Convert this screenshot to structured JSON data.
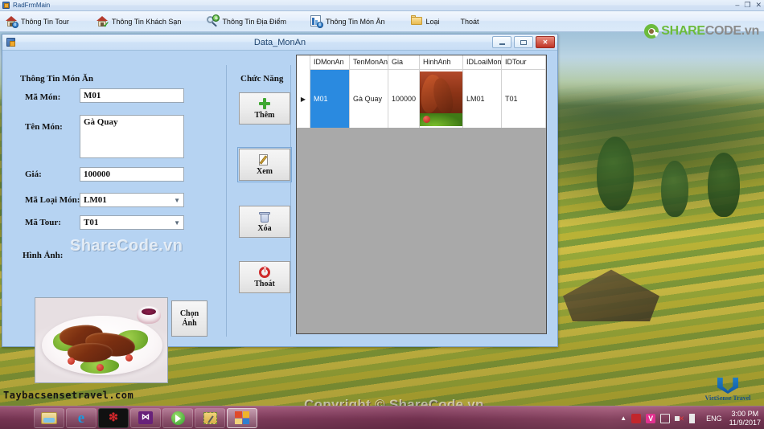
{
  "main_window": {
    "title": "RadFrmMain",
    "icon": "windows-form-icon",
    "controls": {
      "minimize": "minimize-icon",
      "restore": "restore-icon",
      "close": "close-icon"
    }
  },
  "menu": {
    "items": [
      {
        "label": "Thông Tin Tour",
        "icon": "house-info-icon"
      },
      {
        "label": "Thông Tin Khách Sạn",
        "icon": "house-check-icon"
      },
      {
        "label": "Thông Tin Địa Điểm",
        "icon": "search-plus-icon"
      },
      {
        "label": "Thông Tin Món Ăn",
        "icon": "document-info-icon"
      },
      {
        "label": "Loại",
        "icon": "folder-icon"
      },
      {
        "label": "Thoát",
        "icon": ""
      }
    ]
  },
  "brand": {
    "logo_green": "SHARE",
    "logo_gray": "CODE.vn",
    "mark": "sharecode-logo-icon"
  },
  "child_window": {
    "title": "Data_MonAn",
    "icon": "form-icon",
    "buttons": {
      "minimize": "minimize-icon",
      "maximize": "maximize-icon",
      "close": "close-icon"
    }
  },
  "form": {
    "group_title": "Thông Tin Món Ăn",
    "fields": [
      {
        "label": "Mã Món:",
        "value": "M01",
        "type": "textbox"
      },
      {
        "label": "Tên Món:",
        "value": "Gà Quay",
        "type": "multiline"
      },
      {
        "label": "Giá:",
        "value": "100000",
        "type": "textbox"
      },
      {
        "label": "Mã Loại Món:",
        "value": "LM01",
        "type": "combobox"
      },
      {
        "label": "Mã Tour:",
        "value": "T01",
        "type": "combobox"
      }
    ],
    "image_label": "Hình Ảnh:",
    "choose_image_button": "Chọn Ảnh",
    "watermark": "ShareCode.vn"
  },
  "functions": {
    "title": "Chức Năng",
    "buttons": [
      {
        "label": "Thêm",
        "icon": "plus-icon"
      },
      {
        "label": "Xem",
        "icon": "edit-icon"
      },
      {
        "label": "Xóa",
        "icon": "trash-icon"
      },
      {
        "label": "Thoát",
        "icon": "power-icon"
      }
    ]
  },
  "grid": {
    "columns": [
      "IDMonAn",
      "TenMonAn",
      "Gia",
      "HinhAnh",
      "IDLoaiMon",
      "IDTour"
    ],
    "rows": [
      {
        "selector": "▶",
        "IDMonAn": "M01",
        "TenMonAn": "Gà Quay",
        "Gia": "100000",
        "HinhAnh": "roast-chicken-thumbnail",
        "IDLoaiMon": "LM01",
        "IDTour": "T01",
        "selected_cell": "IDMonAn"
      }
    ],
    "selection_color": "#2a8ae0",
    "background_color": "#a9a9a9"
  },
  "desktop": {
    "site_caption": "Taybacsensetravel.com",
    "vietsense_logo": "VietSense Travel",
    "page_watermark": "Copyright © ShareCode.vn"
  },
  "taskbar": {
    "apps": [
      {
        "name": "file-explorer-icon"
      },
      {
        "name": "internet-explorer-icon"
      },
      {
        "name": "app-red-icon"
      },
      {
        "name": "visual-studio-icon"
      },
      {
        "name": "media-player-icon"
      },
      {
        "name": "tools-icon"
      },
      {
        "name": "running-app-icon",
        "active": true
      }
    ],
    "tray": {
      "show_hidden": "chevron-up-icon",
      "icons": [
        "shield-red-icon",
        "v-icon",
        "network-icon",
        "speaker-muted-icon",
        "flag-icon"
      ],
      "language": "ENG",
      "time": "3:00 PM",
      "date": "11/9/2017"
    }
  }
}
